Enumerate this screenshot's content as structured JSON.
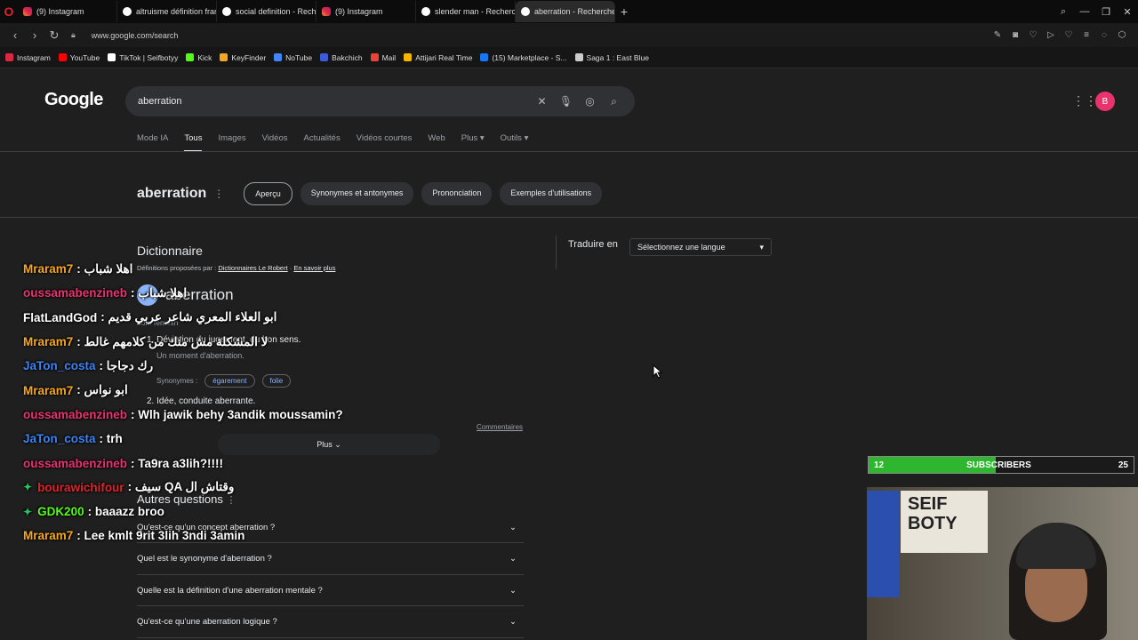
{
  "tabs": [
    {
      "label": "(9) Instagram",
      "icon": "instagram-icon"
    },
    {
      "label": "altruisme définition franç",
      "icon": "google-icon"
    },
    {
      "label": "social definition - Recherc",
      "icon": "google-icon"
    },
    {
      "label": "(9) Instagram",
      "icon": "instagram-icon"
    },
    {
      "label": "slender man - Recherche",
      "icon": "google-icon"
    },
    {
      "label": "aberration - Recherche G",
      "icon": "google-icon",
      "active": true
    }
  ],
  "address": {
    "url": "www.google.com/search"
  },
  "bookmarks": [
    {
      "label": "Instagram",
      "color": "#dc2743"
    },
    {
      "label": "YouTube",
      "color": "#ff0000"
    },
    {
      "label": "TikTok | Seifbotyy",
      "color": "#ffffff"
    },
    {
      "label": "Kick",
      "color": "#53fc18"
    },
    {
      "label": "KeyFinder",
      "color": "#f5a623"
    },
    {
      "label": "NoTube",
      "color": "#4285f4"
    },
    {
      "label": "Bakchich",
      "color": "#3b5bdb"
    },
    {
      "label": "Mail",
      "color": "#ea4335"
    },
    {
      "label": "Attijari Real Time",
      "color": "#f7b500"
    },
    {
      "label": "(15) Marketplace - S...",
      "color": "#1877f2"
    },
    {
      "label": "Saga 1 : East Blue",
      "color": "#cccccc"
    }
  ],
  "google": {
    "logo": "Google",
    "query": "aberration",
    "avatar_letter": "B",
    "nav": [
      "Mode IA",
      "Tous",
      "Images",
      "Vidéos",
      "Actualités",
      "Vidéos courtes",
      "Web",
      "Plus ▾",
      "Outils ▾"
    ],
    "word": "aberration",
    "chips": [
      "Aperçu",
      "Synonymes et antonymes",
      "Prononciation",
      "Exemples d'utilisations"
    ],
    "dict_title": "Dictionnaire",
    "dict_src_prefix": "Définitions proposées par :",
    "dict_src_link1": "Dictionnaires Le Robert",
    "dict_src_link2": "En savoir plus",
    "headword": "aberration",
    "pos": "nom féminin",
    "def1": "1. Déviation du jugement, du bon sens.",
    "ex1": "Un moment d'aberration.",
    "syn_label": "Synonymes :",
    "syn_words": [
      "égarement",
      "folie"
    ],
    "def2": "2. Idée, conduite aberrante.",
    "comments": "Commentaires",
    "more": "Plus ⌄",
    "translate_label": "Traduire en",
    "translate_select": "Sélectionnez une langue",
    "aq_title": "Autres questions",
    "aq": [
      "Qu'est-ce qu'un concept aberration ?",
      "Quel est le synonyme d'aberration ?",
      "Quelle est la définition d'une aberration mentale ?",
      "Qu'est-ce qu'une aberration logique ?"
    ]
  },
  "chat": [
    {
      "user": "Mraram7",
      "color": "#f5a623",
      "text": ": اهلا شباب",
      "badge": false
    },
    {
      "user": "oussamabenzineb",
      "color": "#e8336f",
      "text": ": اهلا شباب",
      "badge": false
    },
    {
      "user": "FlatLandGod",
      "color": "#ffffff",
      "text": ": ابو العلاء المعري شاعر عربي قديم",
      "badge": false
    },
    {
      "user": "Mraram7",
      "color": "#f5a623",
      "text": ": لا المشكلة مش منك من كلامهم غالط",
      "badge": false
    },
    {
      "user": "JaTon_costa",
      "color": "#3b82f6",
      "text": ": رك دجاجا",
      "badge": false
    },
    {
      "user": "Mraram7",
      "color": "#f5a623",
      "text": ": ابو نواس",
      "badge": false
    },
    {
      "user": "oussamabenzineb",
      "color": "#e8336f",
      "text": ": Wlh jawik behy 3andik moussamin?",
      "badge": false
    },
    {
      "user": "JaTon_costa",
      "color": "#3b82f6",
      "text": ": trh",
      "badge": false
    },
    {
      "user": "oussamabenzineb",
      "color": "#e8336f",
      "text": ": Ta9ra a3lih?!!!!",
      "badge": false
    },
    {
      "user": "bourawichifour",
      "color": "#e0232b",
      "text": ": سيف QA وقتاش ال",
      "badge": true
    },
    {
      "user": "GDK200",
      "color": "#53fc18",
      "text": ": baaazz broo",
      "badge": true
    },
    {
      "user": "Mraram7",
      "color": "#f5a623",
      "text": ": Lee kmlt 9rit 3lih 3ndi 3amin",
      "badge": false
    }
  ],
  "subscribers": {
    "current": "12",
    "label": "SUBSCRIBERS",
    "goal": "25",
    "progress": 0.48
  },
  "webcam": {
    "poster_text": "SEIF BOTY"
  }
}
